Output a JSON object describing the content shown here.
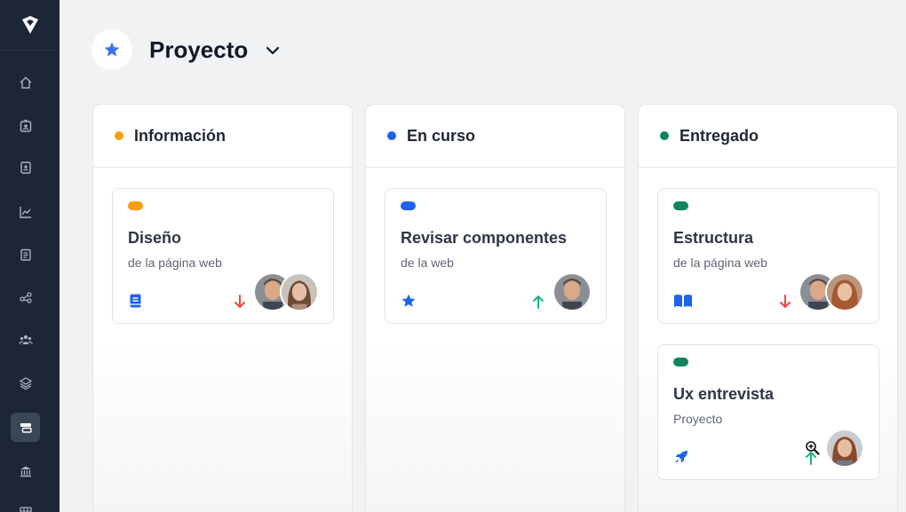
{
  "header": {
    "title": "Proyecto",
    "star_icon": "star-icon",
    "chevron_icon": "chevron-down-icon"
  },
  "sidebar": {
    "logo_icon": "diamond-logo-icon",
    "items": [
      {
        "name": "home-icon"
      },
      {
        "name": "id-badge-icon"
      },
      {
        "name": "contacts-icon"
      },
      {
        "name": "chart-icon"
      },
      {
        "name": "clipboard-icon"
      },
      {
        "name": "share-icon"
      },
      {
        "name": "users-icon"
      },
      {
        "name": "layers-icon"
      },
      {
        "name": "board-icon",
        "active": true
      },
      {
        "name": "bank-icon"
      },
      {
        "name": "table-icon"
      }
    ]
  },
  "colors": {
    "orange": "#f59f0b",
    "blue": "#1d63ed",
    "green": "#10855c",
    "down_arrow": "#ef4444",
    "up_arrow": "#10b981"
  },
  "columns": [
    {
      "title": "Información",
      "dot_color": "#f59f0b",
      "cards": [
        {
          "title": "Diseño",
          "subtitle": "de la página web",
          "pill_color": "#f59f0b",
          "icon": "book-icon",
          "trend": "down"
        }
      ]
    },
    {
      "title": "En curso",
      "dot_color": "#1d63ed",
      "cards": [
        {
          "title": "Revisar componentes",
          "subtitle": "de la web",
          "pill_color": "#1d63ed",
          "icon": "star-icon",
          "trend": "up"
        }
      ]
    },
    {
      "title": "Entregado",
      "dot_color": "#10855c",
      "cards": [
        {
          "title": "Estructura",
          "subtitle": "de la página web",
          "pill_color": "#10855c",
          "icon": "open-book-icon",
          "trend": "down"
        },
        {
          "title": "Ux entrevista",
          "subtitle": "Proyecto",
          "pill_color": "#10855c",
          "icon": "rocket-icon",
          "trend": "up"
        }
      ]
    }
  ]
}
